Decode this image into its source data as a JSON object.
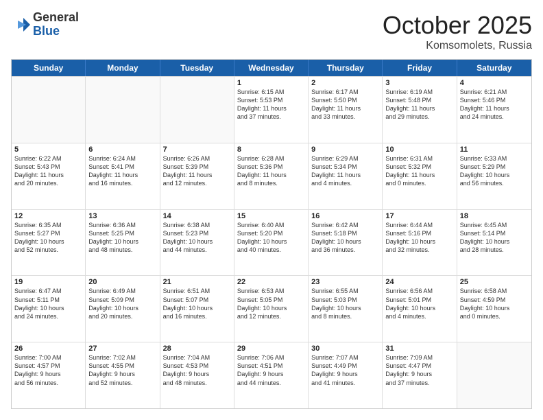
{
  "logo": {
    "general": "General",
    "blue": "Blue"
  },
  "header": {
    "month": "October 2025",
    "location": "Komsomolets, Russia"
  },
  "weekdays": [
    "Sunday",
    "Monday",
    "Tuesday",
    "Wednesday",
    "Thursday",
    "Friday",
    "Saturday"
  ],
  "rows": [
    [
      {
        "day": "",
        "info": "",
        "empty": true
      },
      {
        "day": "",
        "info": "",
        "empty": true
      },
      {
        "day": "",
        "info": "",
        "empty": true
      },
      {
        "day": "1",
        "info": "Sunrise: 6:15 AM\nSunset: 5:53 PM\nDaylight: 11 hours\nand 37 minutes."
      },
      {
        "day": "2",
        "info": "Sunrise: 6:17 AM\nSunset: 5:50 PM\nDaylight: 11 hours\nand 33 minutes."
      },
      {
        "day": "3",
        "info": "Sunrise: 6:19 AM\nSunset: 5:48 PM\nDaylight: 11 hours\nand 29 minutes."
      },
      {
        "day": "4",
        "info": "Sunrise: 6:21 AM\nSunset: 5:46 PM\nDaylight: 11 hours\nand 24 minutes."
      }
    ],
    [
      {
        "day": "5",
        "info": "Sunrise: 6:22 AM\nSunset: 5:43 PM\nDaylight: 11 hours\nand 20 minutes."
      },
      {
        "day": "6",
        "info": "Sunrise: 6:24 AM\nSunset: 5:41 PM\nDaylight: 11 hours\nand 16 minutes."
      },
      {
        "day": "7",
        "info": "Sunrise: 6:26 AM\nSunset: 5:39 PM\nDaylight: 11 hours\nand 12 minutes."
      },
      {
        "day": "8",
        "info": "Sunrise: 6:28 AM\nSunset: 5:36 PM\nDaylight: 11 hours\nand 8 minutes."
      },
      {
        "day": "9",
        "info": "Sunrise: 6:29 AM\nSunset: 5:34 PM\nDaylight: 11 hours\nand 4 minutes."
      },
      {
        "day": "10",
        "info": "Sunrise: 6:31 AM\nSunset: 5:32 PM\nDaylight: 11 hours\nand 0 minutes."
      },
      {
        "day": "11",
        "info": "Sunrise: 6:33 AM\nSunset: 5:29 PM\nDaylight: 10 hours\nand 56 minutes."
      }
    ],
    [
      {
        "day": "12",
        "info": "Sunrise: 6:35 AM\nSunset: 5:27 PM\nDaylight: 10 hours\nand 52 minutes."
      },
      {
        "day": "13",
        "info": "Sunrise: 6:36 AM\nSunset: 5:25 PM\nDaylight: 10 hours\nand 48 minutes."
      },
      {
        "day": "14",
        "info": "Sunrise: 6:38 AM\nSunset: 5:23 PM\nDaylight: 10 hours\nand 44 minutes."
      },
      {
        "day": "15",
        "info": "Sunrise: 6:40 AM\nSunset: 5:20 PM\nDaylight: 10 hours\nand 40 minutes."
      },
      {
        "day": "16",
        "info": "Sunrise: 6:42 AM\nSunset: 5:18 PM\nDaylight: 10 hours\nand 36 minutes."
      },
      {
        "day": "17",
        "info": "Sunrise: 6:44 AM\nSunset: 5:16 PM\nDaylight: 10 hours\nand 32 minutes."
      },
      {
        "day": "18",
        "info": "Sunrise: 6:45 AM\nSunset: 5:14 PM\nDaylight: 10 hours\nand 28 minutes."
      }
    ],
    [
      {
        "day": "19",
        "info": "Sunrise: 6:47 AM\nSunset: 5:11 PM\nDaylight: 10 hours\nand 24 minutes."
      },
      {
        "day": "20",
        "info": "Sunrise: 6:49 AM\nSunset: 5:09 PM\nDaylight: 10 hours\nand 20 minutes."
      },
      {
        "day": "21",
        "info": "Sunrise: 6:51 AM\nSunset: 5:07 PM\nDaylight: 10 hours\nand 16 minutes."
      },
      {
        "day": "22",
        "info": "Sunrise: 6:53 AM\nSunset: 5:05 PM\nDaylight: 10 hours\nand 12 minutes."
      },
      {
        "day": "23",
        "info": "Sunrise: 6:55 AM\nSunset: 5:03 PM\nDaylight: 10 hours\nand 8 minutes."
      },
      {
        "day": "24",
        "info": "Sunrise: 6:56 AM\nSunset: 5:01 PM\nDaylight: 10 hours\nand 4 minutes."
      },
      {
        "day": "25",
        "info": "Sunrise: 6:58 AM\nSunset: 4:59 PM\nDaylight: 10 hours\nand 0 minutes."
      }
    ],
    [
      {
        "day": "26",
        "info": "Sunrise: 7:00 AM\nSunset: 4:57 PM\nDaylight: 9 hours\nand 56 minutes."
      },
      {
        "day": "27",
        "info": "Sunrise: 7:02 AM\nSunset: 4:55 PM\nDaylight: 9 hours\nand 52 minutes."
      },
      {
        "day": "28",
        "info": "Sunrise: 7:04 AM\nSunset: 4:53 PM\nDaylight: 9 hours\nand 48 minutes."
      },
      {
        "day": "29",
        "info": "Sunrise: 7:06 AM\nSunset: 4:51 PM\nDaylight: 9 hours\nand 44 minutes."
      },
      {
        "day": "30",
        "info": "Sunrise: 7:07 AM\nSunset: 4:49 PM\nDaylight: 9 hours\nand 41 minutes."
      },
      {
        "day": "31",
        "info": "Sunrise: 7:09 AM\nSunset: 4:47 PM\nDaylight: 9 hours\nand 37 minutes."
      },
      {
        "day": "",
        "info": "",
        "empty": true
      }
    ]
  ]
}
